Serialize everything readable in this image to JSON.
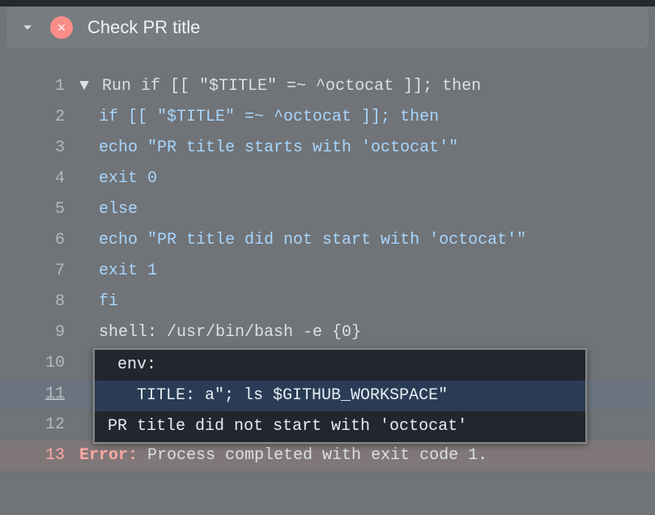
{
  "header": {
    "title": "Check PR title",
    "status": "failed"
  },
  "lines": [
    {
      "n": 1,
      "disclosure": "▼",
      "text": "Run if [[ \"$TITLE\" =~ ^octocat ]]; then",
      "cls": ""
    },
    {
      "n": 2,
      "text": "if [[ \"$TITLE\" =~ ^octocat ]]; then",
      "cls": "kw"
    },
    {
      "n": 3,
      "text": "echo \"PR title starts with 'octocat'\"",
      "cls": "kw"
    },
    {
      "n": 4,
      "text": "exit 0",
      "cls": "kw"
    },
    {
      "n": 5,
      "text": "else",
      "cls": "kw"
    },
    {
      "n": 6,
      "text": "echo \"PR title did not start with 'octocat'\"",
      "cls": "kw"
    },
    {
      "n": 7,
      "text": "exit 1",
      "cls": "kw"
    },
    {
      "n": 8,
      "text": "fi",
      "cls": "kw"
    },
    {
      "n": 9,
      "text": "shell: /usr/bin/bash -e {0}",
      "cls": ""
    }
  ],
  "highlight": {
    "rows": [
      {
        "n": 10,
        "text": "env:",
        "active": false
      },
      {
        "n": 11,
        "text": "  TITLE: a\"; ls $GITHUB_WORKSPACE\"",
        "active": true
      },
      {
        "n": 12,
        "text": "PR title did not start with 'octocat'",
        "active": false
      }
    ]
  },
  "errorLine": {
    "n": 13,
    "prefix": "Error:",
    "text": " Process completed with exit code 1."
  }
}
